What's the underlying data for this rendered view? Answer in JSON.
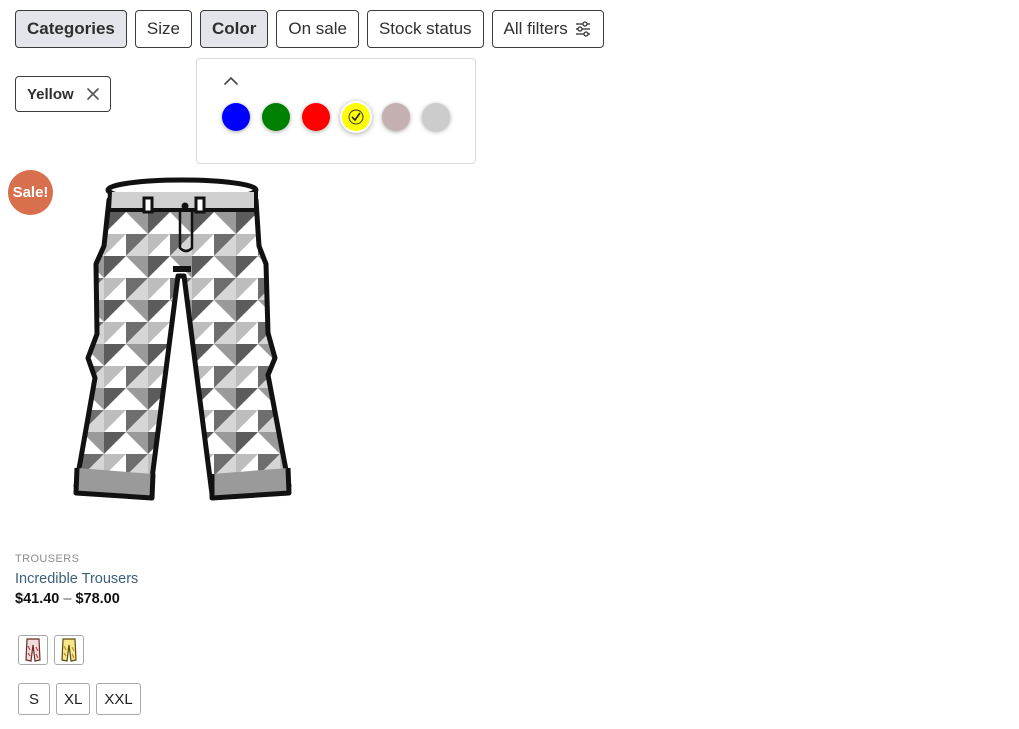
{
  "filters": [
    {
      "label": "Categories",
      "active": true
    },
    {
      "label": "Size",
      "active": false
    },
    {
      "label": "Color",
      "active": true
    },
    {
      "label": "On sale",
      "active": false
    },
    {
      "label": "Stock status",
      "active": false
    },
    {
      "label": "All filters",
      "active": false,
      "icon": "sliders-icon"
    }
  ],
  "active_filter_chip": {
    "label": "Yellow",
    "icon": "close-icon"
  },
  "color_popover": {
    "collapse_icon": "chevron-up-icon",
    "swatches": [
      {
        "color": "#0000ff",
        "selected": false
      },
      {
        "color": "#008000",
        "selected": false
      },
      {
        "color": "#ff0000",
        "selected": false
      },
      {
        "color": "#ffff00",
        "selected": true
      },
      {
        "color": "#c4b0b0",
        "selected": false
      },
      {
        "color": "#cccccc",
        "selected": false
      }
    ]
  },
  "product": {
    "badge": "Sale!",
    "badge_color": "#d8704d",
    "category": "TROUSERS",
    "title": "Incredible Trousers",
    "price_low": "$41.40",
    "price_sep": "–",
    "price_high": "$78.00",
    "variant_thumbnails": [
      "trousers-red-pattern",
      "trousers-yellow-pattern"
    ],
    "sizes": [
      "S",
      "XL",
      "XXL"
    ]
  }
}
